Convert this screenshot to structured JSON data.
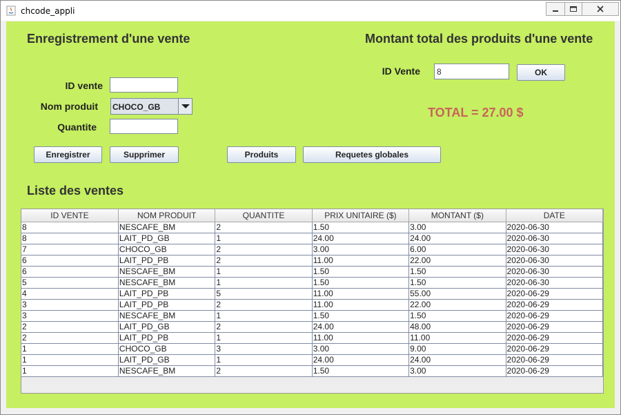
{
  "window": {
    "title": "chcode_appli"
  },
  "left_section": {
    "heading": "Enregistrement d'une vente",
    "id_vente_label": "ID vente",
    "nom_produit_label": "Nom produit",
    "quantite_label": "Quantite",
    "id_vente_value": "",
    "quantite_value": "",
    "nom_produit_selected": "CHOCO_GB"
  },
  "right_section": {
    "heading": "Montant total des produits d'une vente",
    "id_vente_label": "ID Vente",
    "id_vente_value": "8",
    "ok_label": "OK",
    "total_text": "TOTAL = 27.00 $",
    "total_color": "#c8645a"
  },
  "buttons": {
    "enregistrer": "Enregistrer",
    "supprimer": "Supprimer",
    "produits": "Produits",
    "requetes": "Requetes globales"
  },
  "list": {
    "heading": "Liste des ventes",
    "columns": [
      "ID VENTE",
      "NOM PRODUIT",
      "QUANTITE",
      "PRIX UNITAIRE ($)",
      "MONTANT ($)",
      "DATE"
    ],
    "rows": [
      [
        "8",
        "NESCAFE_BM",
        "2",
        "1.50",
        "3.00",
        "2020-06-30"
      ],
      [
        "8",
        "LAIT_PD_GB",
        "1",
        "24.00",
        "24.00",
        "2020-06-30"
      ],
      [
        "7",
        "CHOCO_GB",
        "2",
        "3.00",
        "6.00",
        "2020-06-30"
      ],
      [
        "6",
        "LAIT_PD_PB",
        "2",
        "11.00",
        "22.00",
        "2020-06-30"
      ],
      [
        "6",
        "NESCAFE_BM",
        "1",
        "1.50",
        "1.50",
        "2020-06-30"
      ],
      [
        "5",
        "NESCAFE_BM",
        "1",
        "1.50",
        "1.50",
        "2020-06-30"
      ],
      [
        "4",
        "LAIT_PD_PB",
        "5",
        "11.00",
        "55.00",
        "2020-06-29"
      ],
      [
        "3",
        "LAIT_PD_PB",
        "2",
        "11.00",
        "22.00",
        "2020-06-29"
      ],
      [
        "3",
        "NESCAFE_BM",
        "1",
        "1.50",
        "1.50",
        "2020-06-29"
      ],
      [
        "2",
        "LAIT_PD_GB",
        "2",
        "24.00",
        "48.00",
        "2020-06-29"
      ],
      [
        "2",
        "LAIT_PD_PB",
        "1",
        "11.00",
        "11.00",
        "2020-06-29"
      ],
      [
        "1",
        "CHOCO_GB",
        "3",
        "3.00",
        "9.00",
        "2020-06-29"
      ],
      [
        "1",
        "LAIT_PD_GB",
        "1",
        "24.00",
        "24.00",
        "2020-06-29"
      ],
      [
        "1",
        "NESCAFE_BM",
        "2",
        "1.50",
        "3.00",
        "2020-06-29"
      ]
    ]
  },
  "colors": {
    "panel_background": "#c6ef62",
    "heading_text": "#333333"
  }
}
